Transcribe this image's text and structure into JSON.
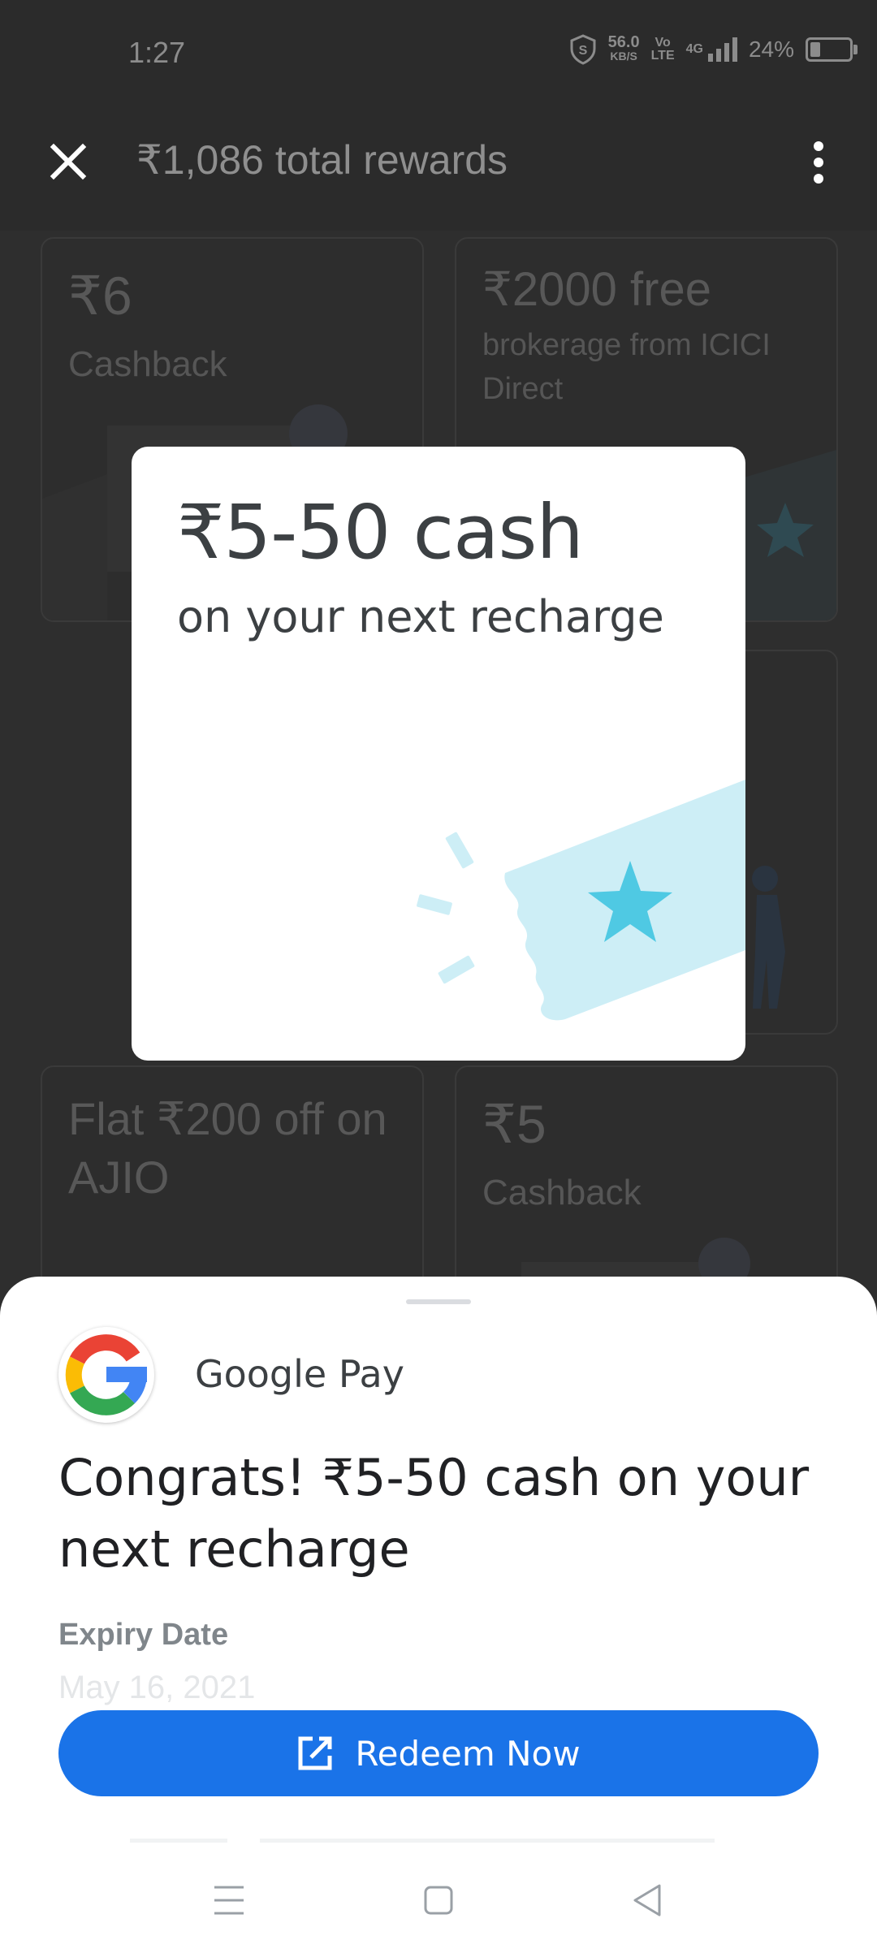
{
  "status_bar": {
    "time": "1:27",
    "speed_value": "56.0",
    "speed_unit": "KB/S",
    "volte_top": "Vo",
    "volte_bottom": "LTE",
    "network": "4G",
    "battery": "24%"
  },
  "app_bar": {
    "title": "₹1,086 total rewards",
    "close_icon": "close-icon",
    "menu_icon": "more-vert-icon"
  },
  "cards": [
    {
      "title": "₹6",
      "subtitle": "Cashback"
    },
    {
      "title": "₹2000 free",
      "subtitle": "brokerage from ICICI Direct"
    },
    {
      "title": "Flat ₹200 off on AJIO",
      "subtitle": ""
    },
    {
      "title": "₹5",
      "subtitle": "Cashback"
    }
  ],
  "modal": {
    "amount": "₹5-50 cash",
    "description": "on your next recharge"
  },
  "sheet": {
    "brand": "Google Pay",
    "headline": "Congrats! ₹5-50 cash on your next recharge",
    "expiry_label": "Expiry Date",
    "expiry_value": "May 16, 2021",
    "redeem_label": "Redeem Now"
  },
  "colors": {
    "accent": "#1a73e8",
    "ticket": "#cdeef6",
    "star": "#4fc9e3"
  }
}
